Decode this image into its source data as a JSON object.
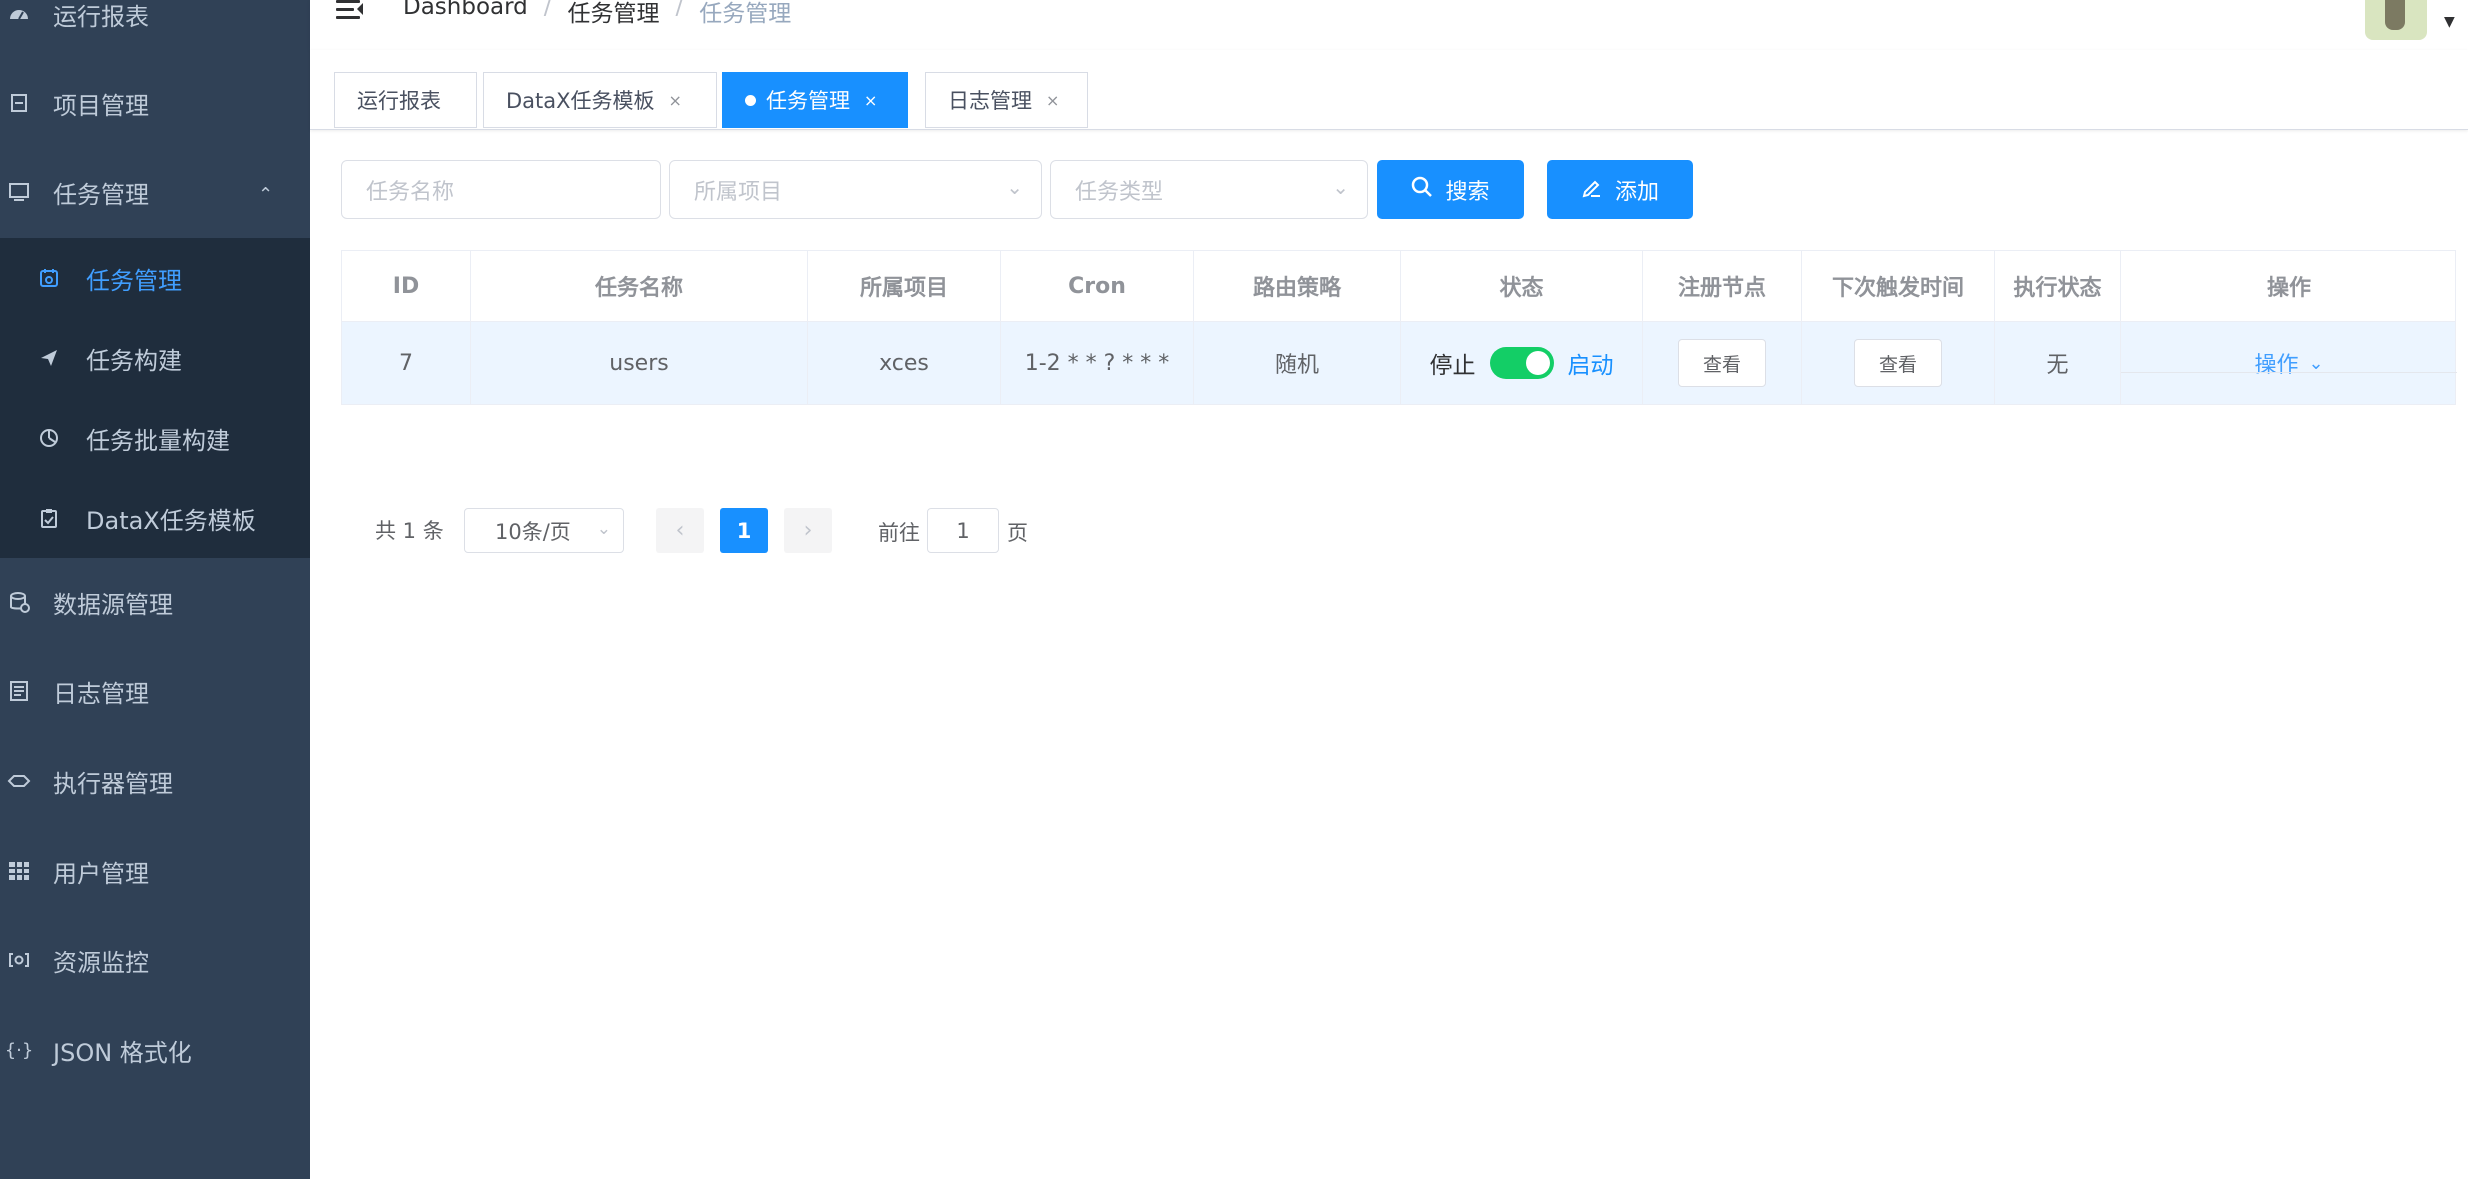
{
  "sidebar": {
    "items": [
      {
        "label": "运行报表",
        "icon": "dashboard-icon"
      },
      {
        "label": "项目管理",
        "icon": "project-icon"
      },
      {
        "label": "任务管理",
        "icon": "monitor-icon"
      },
      {
        "label": "数据源管理",
        "icon": "database-icon"
      },
      {
        "label": "日志管理",
        "icon": "log-icon"
      },
      {
        "label": "执行器管理",
        "icon": "executor-icon"
      },
      {
        "label": "用户管理",
        "icon": "grid-icon"
      },
      {
        "label": "资源监控",
        "icon": "monitor-resource-icon"
      },
      {
        "label": "JSON 格式化",
        "icon": "braces-icon"
      }
    ],
    "submenu": [
      {
        "label": "任务管理",
        "icon": "calendar-icon",
        "active": true
      },
      {
        "label": "任务构建",
        "icon": "paper-plane-icon"
      },
      {
        "label": "任务批量构建",
        "icon": "chart-icon"
      },
      {
        "label": "DataX任务模板",
        "icon": "clipboard-icon"
      }
    ]
  },
  "navbar": {
    "breadcrumb": [
      "Dashboard",
      "任务管理",
      "任务管理"
    ],
    "separator": "/"
  },
  "tags": [
    {
      "label": "运行报表",
      "closable": false,
      "active": false
    },
    {
      "label": "DataX任务模板",
      "closable": true,
      "active": false
    },
    {
      "label": "任务管理",
      "closable": true,
      "active": true
    },
    {
      "label": "日志管理",
      "closable": true,
      "active": false
    }
  ],
  "filters": {
    "task_name_placeholder": "任务名称",
    "project_placeholder": "所属项目",
    "task_type_placeholder": "任务类型",
    "search_label": "搜索",
    "add_label": "添加"
  },
  "table": {
    "headers": [
      "ID",
      "任务名称",
      "所属项目",
      "Cron",
      "路由策略",
      "状态",
      "注册节点",
      "下次触发时间",
      "执行状态",
      "操作"
    ],
    "rows": [
      {
        "id": "7",
        "name": "users",
        "project": "xces",
        "cron": "1-2 * * ? * * *",
        "route": "随机",
        "status_off": "停止",
        "status_on": "启动",
        "status_enabled": true,
        "registry_btn": "查看",
        "next_trigger_btn": "查看",
        "exec_status": "无",
        "op_label": "操作"
      }
    ]
  },
  "pagination": {
    "total_text": "共 1 条",
    "page_size": "10条/页",
    "current_page": "1",
    "goto_label": "前往",
    "goto_value": "1",
    "page_unit": "页"
  },
  "colors": {
    "sidebar_bg": "#304156",
    "submenu_bg": "#1f2d3d",
    "primary": "#1890ff",
    "switch_on": "#13ce66"
  }
}
